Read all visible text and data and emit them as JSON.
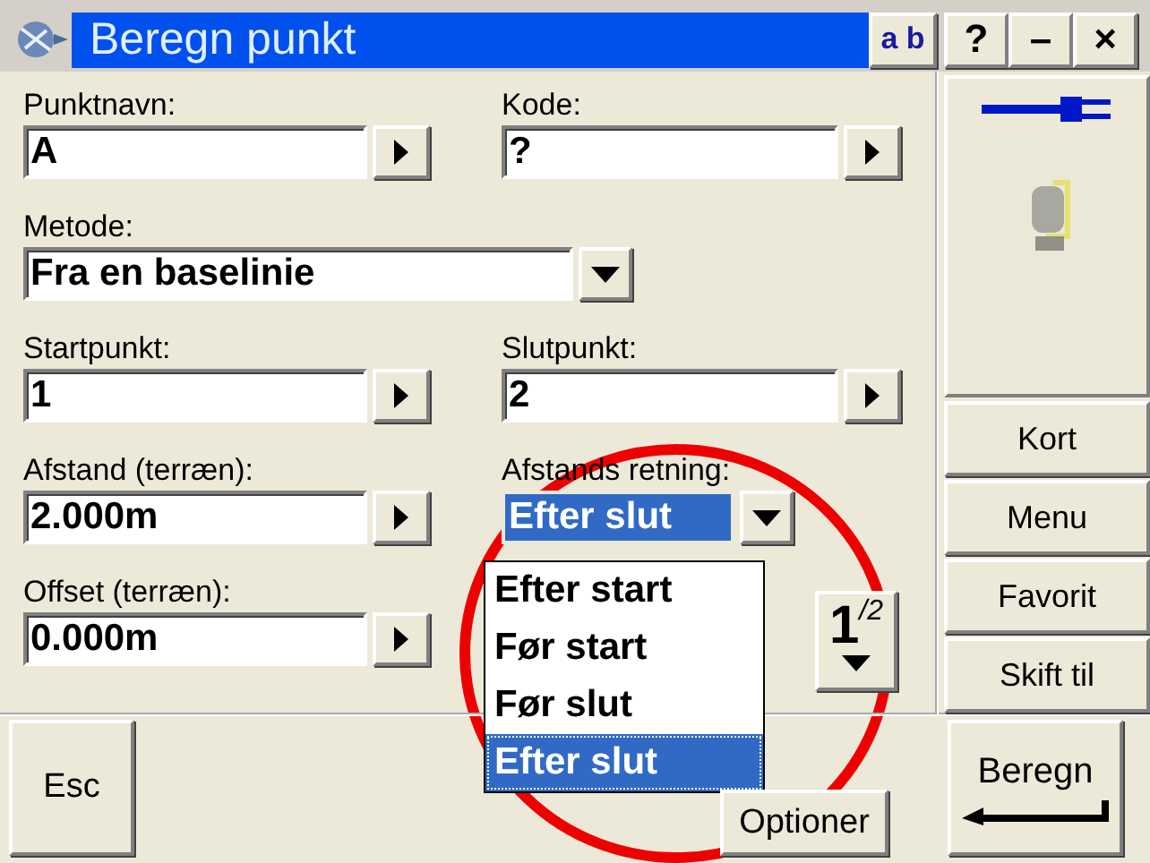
{
  "window": {
    "title": "Beregn punkt",
    "input_mode": "a b",
    "buttons": [
      "?",
      "–",
      "×"
    ]
  },
  "form": {
    "fields": [
      {
        "label": "Punktnavn:",
        "value": "A",
        "kind": "text",
        "focused": false
      },
      {
        "label": "Kode:",
        "value": "?",
        "kind": "text",
        "focused": false
      },
      {
        "label": "Metode:",
        "value": "Fra en baselinie",
        "kind": "dropdown",
        "focused": false
      },
      {
        "label": "Startpunkt:",
        "value": "1",
        "kind": "text",
        "focused": false
      },
      {
        "label": "Slutpunkt:",
        "value": "2",
        "kind": "text",
        "focused": false
      },
      {
        "label": "Afstand (terræn):",
        "value": "2.000m",
        "kind": "text",
        "focused": false
      },
      {
        "label": "Afstands retning:",
        "value": "Efter slut",
        "kind": "dropdown",
        "focused": true
      },
      {
        "label": "Offset (terræn):",
        "value": "0.000m",
        "kind": "text",
        "focused": false
      }
    ],
    "open_list": {
      "options": [
        {
          "label": "Efter start",
          "selected": false
        },
        {
          "label": "Før start",
          "selected": false
        },
        {
          "label": "Før slut",
          "selected": false
        },
        {
          "label": "Efter slut",
          "selected": true
        }
      ]
    },
    "page_indicator": "1$^{/2}$"
  },
  "side_panel": {
    "buttons": [
      "Kort",
      "Menu",
      "Favorit",
      "Skift til"
    ]
  },
  "bottom_bar": {
    "buttons": [
      "Esc",
      "Optioner",
      "Beregn"
    ]
  }
}
